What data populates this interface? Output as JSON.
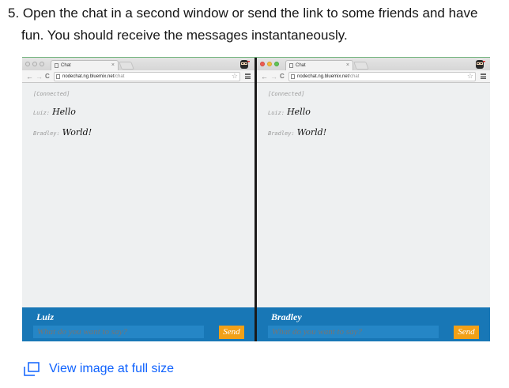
{
  "instruction": {
    "number": "5.",
    "line1": "Open the chat in a second window or send the link to some friends and have",
    "line2": "fun. You should receive the messages instantaneously."
  },
  "windows": [
    {
      "tab_title": "Chat",
      "url_host": "nodechat.ng.bluemix.net",
      "url_path": "/chat",
      "status": "[Connected]",
      "messages": [
        {
          "user": "Luiz:",
          "text": "Hello"
        },
        {
          "user": "Bradley:",
          "text": "World!"
        }
      ],
      "username": "Luiz",
      "input_placeholder": "What do you want to say?",
      "send_label": "Send"
    },
    {
      "tab_title": "Chat",
      "url_host": "nodechat.ng.bluemix.net",
      "url_path": "/chat",
      "status": "[Connected]",
      "messages": [
        {
          "user": "Luiz:",
          "text": "Hello"
        },
        {
          "user": "Bradley:",
          "text": "World!"
        }
      ],
      "username": "Bradley",
      "input_placeholder": "What do you want to say?",
      "send_label": "Send"
    }
  ],
  "full_size_link": "View image at full size",
  "icons": {
    "back": "←",
    "forward": "→",
    "reload": "C",
    "star": "☆",
    "close": "×"
  },
  "colors": {
    "link": "#0f62fe",
    "chat_footer": "#1877b6",
    "send_button": "#f2a017"
  }
}
